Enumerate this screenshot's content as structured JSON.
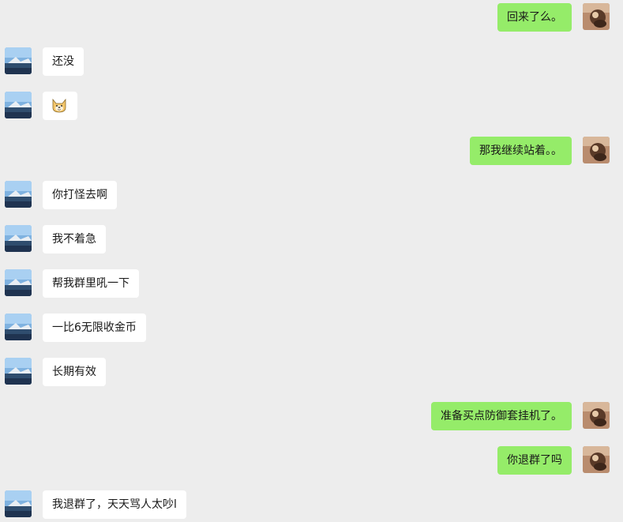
{
  "chat": {
    "accent_color_self": "#95ec69",
    "bubble_color_other": "#ffffff",
    "background": "#ededed",
    "messages": [
      {
        "side": "right",
        "text": "回来了么。"
      },
      {
        "side": "left",
        "text": "还没"
      },
      {
        "side": "left",
        "text": "",
        "icon": "doge-emoji-icon"
      },
      {
        "side": "right",
        "text": "那我继续站着。。"
      },
      {
        "side": "left",
        "text": "你打怪去啊"
      },
      {
        "side": "left",
        "text": "我不着急"
      },
      {
        "side": "left",
        "text": "帮我群里吼一下"
      },
      {
        "side": "left",
        "text": "一比6无限收金币"
      },
      {
        "side": "left",
        "text": "长期有效"
      },
      {
        "side": "right",
        "text": "准备买点防御套挂机了。"
      },
      {
        "side": "right",
        "text": "你退群了吗"
      },
      {
        "side": "left",
        "text": "我退群了，天天骂人太吵l"
      }
    ]
  }
}
